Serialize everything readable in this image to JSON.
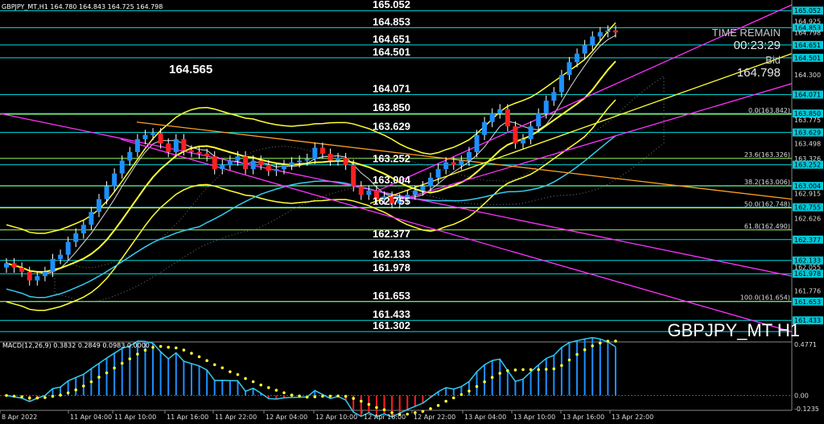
{
  "header": {
    "text": "GBPJPY_MT,H1  164.780 164.843 164.725 164.798"
  },
  "chart_data": {
    "type": "candlestick",
    "symbol": "GBPJPY_MT H1",
    "ylim": [
      161.2,
      165.12
    ],
    "time_labels": [
      "8 Apr 2022",
      "11 Apr 04:00",
      "11 Apr 10:00",
      "11 Apr 16:00",
      "11 Apr 22:00",
      "12 Apr 04:00",
      "12 Apr 10:00",
      "12 Apr 16:00",
      "12 Apr 22:00",
      "13 Apr 04:00",
      "13 Apr 10:00",
      "13 Apr 16:00",
      "13 Apr 22:00"
    ],
    "price_ticks": [
      "165.052",
      "164.925",
      "164.853",
      "164.798",
      "164.651",
      "164.501",
      "164.300",
      "164.071",
      "163.850",
      "163.775",
      "163.629",
      "163.498",
      "163.326",
      "163.252",
      "163.004",
      "162.915",
      "162.755",
      "162.626",
      "162.377",
      "162.133",
      "162.055",
      "161.978",
      "161.776",
      "161.653",
      "161.433"
    ],
    "levels": [
      {
        "value": 165.052,
        "label": "165.052"
      },
      {
        "value": 164.853,
        "label": "164.853"
      },
      {
        "value": 164.651,
        "label": "164.651"
      },
      {
        "value": 164.501,
        "label": "164.501"
      },
      {
        "value": 164.071,
        "label": "164.071"
      },
      {
        "value": 163.85,
        "label": "163.850"
      },
      {
        "value": 163.629,
        "label": "163.629"
      },
      {
        "value": 163.252,
        "label": "163.252"
      },
      {
        "value": 163.004,
        "label": "163.004"
      },
      {
        "value": 162.755,
        "label": "162.755"
      },
      {
        "value": 162.377,
        "label": "162.377"
      },
      {
        "value": 162.133,
        "label": "162.133"
      },
      {
        "value": 161.978,
        "label": "161.978"
      },
      {
        "value": 161.653,
        "label": "161.653"
      },
      {
        "value": 161.433,
        "label": "161.433"
      },
      {
        "value": 161.302,
        "label": "161.302"
      }
    ],
    "fib_levels": [
      {
        "value": 163.842,
        "label": "0.0(163.842)"
      },
      {
        "value": 163.326,
        "label": "23.6(163.326)"
      },
      {
        "value": 163.006,
        "label": "38.2(163.006)"
      },
      {
        "value": 162.748,
        "label": "50.0(162.748)"
      },
      {
        "value": 162.49,
        "label": "61.8(162.490)"
      },
      {
        "value": 161.654,
        "label": "100.0(161.654)"
      }
    ],
    "annotation_high": "164.565",
    "closes": [
      162.1,
      162.05,
      162.0,
      161.9,
      161.95,
      162.0,
      162.15,
      162.2,
      162.35,
      162.45,
      162.55,
      162.7,
      162.85,
      163.0,
      163.15,
      163.3,
      163.4,
      163.55,
      163.6,
      163.62,
      163.5,
      163.4,
      163.55,
      163.42,
      163.4,
      163.38,
      163.35,
      163.2,
      163.25,
      163.3,
      163.35,
      163.2,
      163.3,
      163.25,
      163.18,
      163.2,
      163.25,
      163.28,
      163.3,
      163.32,
      163.45,
      163.38,
      163.3,
      163.33,
      163.25,
      163.0,
      162.9,
      162.95,
      162.85,
      162.88,
      162.8,
      162.85,
      162.9,
      162.95,
      163.0,
      163.1,
      163.2,
      163.28,
      163.25,
      163.3,
      163.4,
      163.6,
      163.75,
      163.85,
      163.9,
      163.7,
      163.5,
      163.55,
      163.7,
      163.85,
      164.0,
      164.1,
      164.3,
      164.45,
      164.55,
      164.65,
      164.75,
      164.8,
      164.82,
      164.798
    ],
    "macd": {
      "label": "MACD(12,26,9) 0.3832 0.2849 0.0983 0.0000",
      "ylim": [
        -0.1235,
        0.4771
      ],
      "tick_labels": [
        "0.4771",
        "0.00",
        "-0.1235"
      ]
    }
  },
  "overlay": {
    "time_remain_label": "TIME REMAIN",
    "time_remain_value": "00:23:29",
    "bid_label": "Bid",
    "bid_value": "164.798",
    "watermark": "GBPJPY_MT H1"
  },
  "colors": {
    "level_line": "#00e0e0",
    "fib_line": "#9dff5a",
    "bull_candle": "#1e90ff",
    "bear_candle": "#ff2020",
    "bollinger": "#ffff33",
    "channel": "#ff33ff",
    "ma_cyan": "#33ccee",
    "orange": "#ffa020",
    "macd_signal": "#ffff33"
  }
}
